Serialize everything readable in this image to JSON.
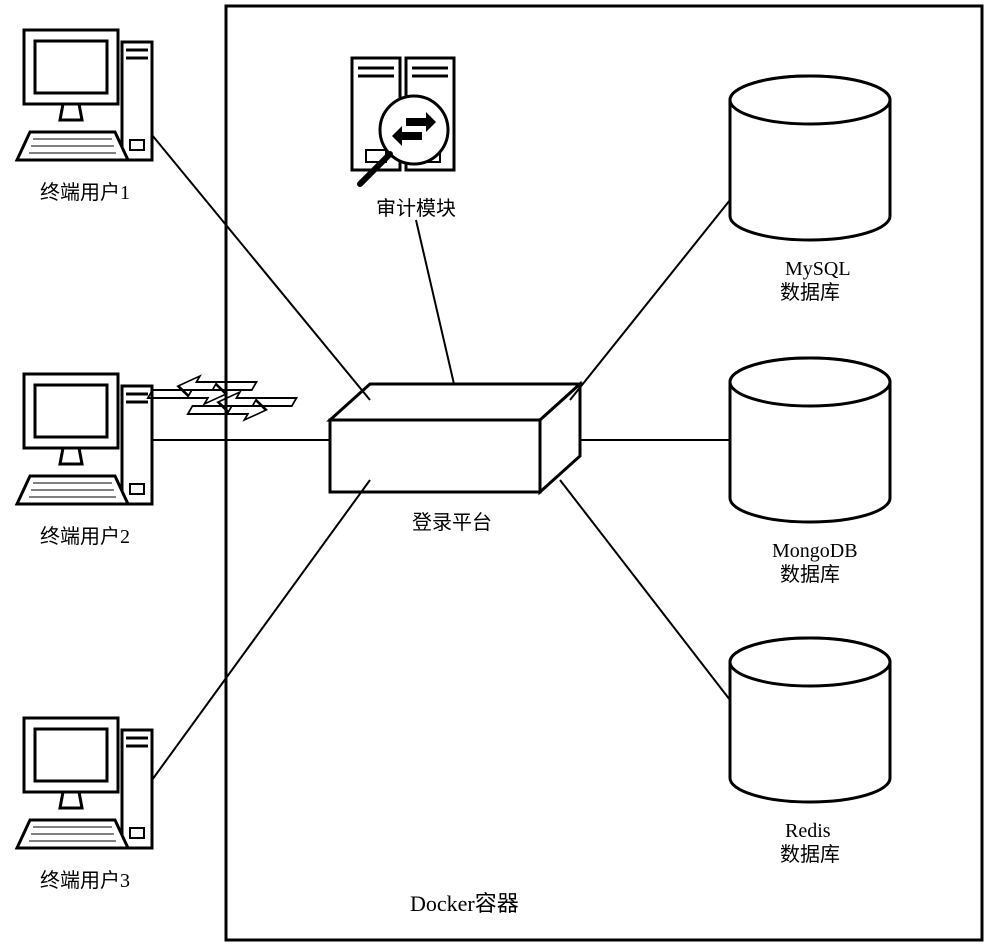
{
  "users": [
    {
      "label": "终端用户1"
    },
    {
      "label": "终端用户2"
    },
    {
      "label": "终端用户3"
    }
  ],
  "audit": {
    "label": "审计模块"
  },
  "platform": {
    "label": "登录平台"
  },
  "databases": [
    {
      "name": "MySQL",
      "sub": "数据库"
    },
    {
      "name": "MongoDB",
      "sub": "数据库"
    },
    {
      "name": "Redis",
      "sub": "数据库"
    }
  ],
  "container": {
    "label": "Docker容器"
  }
}
